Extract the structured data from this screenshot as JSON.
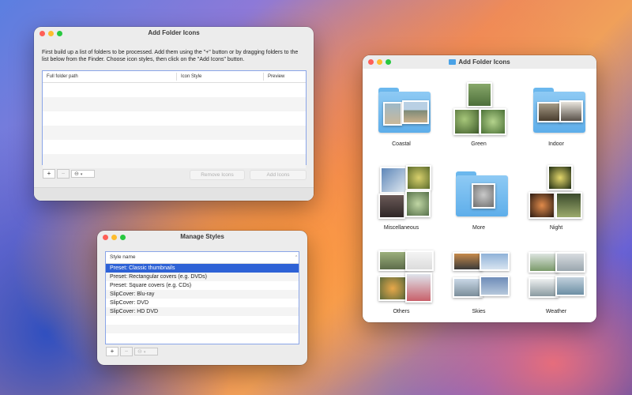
{
  "add_window": {
    "title": "Add Folder Icons",
    "description": "First build up a list of folders to be processed. Add them using the \"+\" button or by dragging folders to the list below from the Finder. Choose icon styles, then click on the \"Add Icons\" button.",
    "columns": [
      "Full folder path",
      "Icon Style",
      "Preview"
    ],
    "add_symbol": "+",
    "remove_symbol": "−",
    "gear_symbol": "⊖",
    "remove_icons_label": "Remove Icons",
    "add_icons_label": "Add Icons"
  },
  "styles_window": {
    "title": "Manage Styles",
    "column": "Style name",
    "sort_symbol": "^",
    "items": [
      "Preset: Classic thumbnails",
      "Preset: Rectangular covers (e.g. DVDs)",
      "Preset: Square covers (e.g. CDs)",
      "SlipCover: Blu-ray",
      "SlipCover: DVD",
      "SlipCover: HD DVD"
    ],
    "add_symbol": "+",
    "remove_symbol": "−",
    "gear_symbol": "⊖"
  },
  "preview_window": {
    "title": "Add Folder Icons",
    "items": [
      {
        "label": "Coastal"
      },
      {
        "label": "Green"
      },
      {
        "label": "Indoor"
      },
      {
        "label": "Miscellaneous"
      },
      {
        "label": "More"
      },
      {
        "label": "Night"
      },
      {
        "label": "Others"
      },
      {
        "label": "Skies"
      },
      {
        "label": "Weather"
      }
    ]
  },
  "colors": {
    "selection": "#2e62d6",
    "folder": "#5eaeea",
    "close": "#fe5f57",
    "minimize": "#febc2e",
    "zoom": "#28c840"
  }
}
